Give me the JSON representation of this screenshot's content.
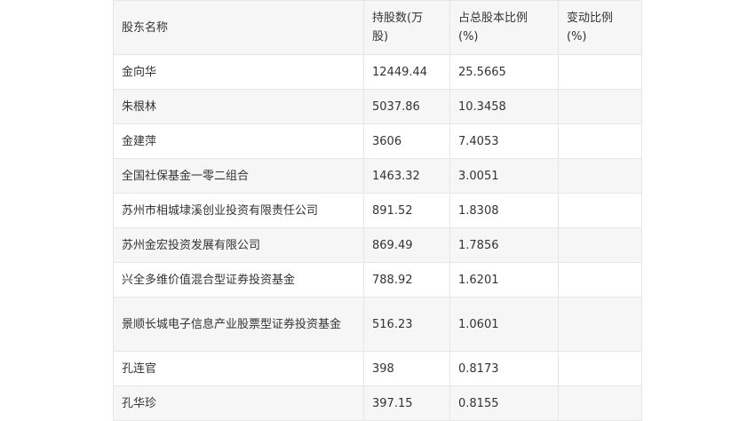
{
  "table": {
    "headers": [
      "股东名称",
      "持股数(万股)",
      "占总股本比例(%)",
      "变动比例(%)"
    ],
    "rows": [
      {
        "name": "金向华",
        "shares": "12449.44",
        "ratio": "25.5665",
        "change": ""
      },
      {
        "name": "朱根林",
        "shares": "5037.86",
        "ratio": "10.3458",
        "change": ""
      },
      {
        "name": "金建萍",
        "shares": "3606",
        "ratio": "7.4053",
        "change": ""
      },
      {
        "name": "全国社保基金一零二组合",
        "shares": "1463.32",
        "ratio": "3.0051",
        "change": ""
      },
      {
        "name": "苏州市相城埭溪创业投资有限责任公司",
        "shares": "891.52",
        "ratio": "1.8308",
        "change": ""
      },
      {
        "name": "苏州金宏投资发展有限公司",
        "shares": "869.49",
        "ratio": "1.7856",
        "change": ""
      },
      {
        "name": "兴全多维价值混合型证券投资基金",
        "shares": "788.92",
        "ratio": "1.6201",
        "change": ""
      },
      {
        "name": "景顺长城电子信息产业股票型证券投资基金",
        "shares": "516.23",
        "ratio": "1.0601",
        "change": ""
      },
      {
        "name": "孔连官",
        "shares": "398",
        "ratio": "0.8173",
        "change": ""
      },
      {
        "name": "孔华珍",
        "shares": "397.15",
        "ratio": "0.8155",
        "change": ""
      }
    ]
  }
}
